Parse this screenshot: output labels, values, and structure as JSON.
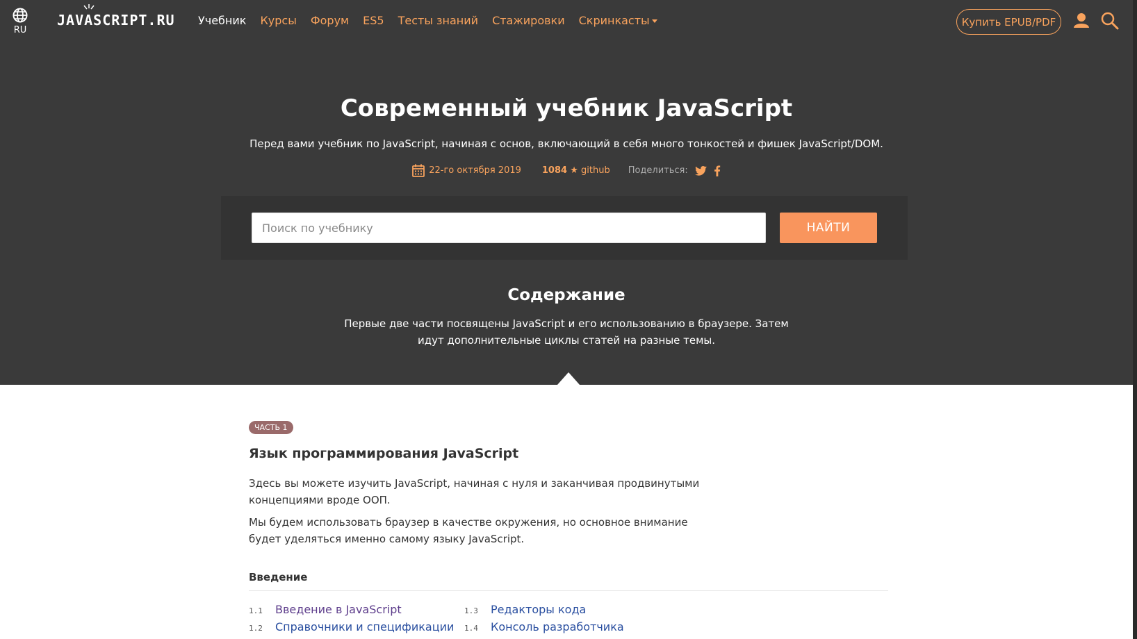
{
  "header": {
    "lang_label": "RU",
    "logo_text": "JAVASCRIPT.RU",
    "nav": [
      {
        "label": "Учебник",
        "active": true
      },
      {
        "label": "Курсы"
      },
      {
        "label": "Форум"
      },
      {
        "label": "ES5"
      },
      {
        "label": "Тесты знаний"
      },
      {
        "label": "Стажировки"
      },
      {
        "label": "Скринкасты",
        "dropdown": true
      }
    ],
    "buy_label": "Купить EPUB/PDF",
    "icons": [
      "globe-icon",
      "user-icon",
      "search-icon"
    ]
  },
  "hero": {
    "title": "Современный учебник JavaScript",
    "description": "Перед вами учебник по JavaScript, начиная с основ, включающий в себя много тонкостей и фишек JavaScript/DOM.",
    "date": "22-го октября 2019",
    "stars_count": "1084",
    "stars_suffix": "★ github",
    "share_label": "Поделиться:",
    "search_placeholder": "Поиск по учебнику",
    "search_button": "НАЙТИ",
    "toc_title": "Содержание",
    "toc_description": "Первые две части посвящены JavaScript и его использованию в браузере. Затем идут дополнительные циклы статей на разные темы."
  },
  "part": {
    "badge": "ЧАСТЬ 1",
    "title": "Язык программирования JavaScript",
    "paragraph1": "Здесь вы можете изучить JavaScript, начиная с нуля и заканчивая продвинутыми концепциями вроде ООП.",
    "paragraph2": "Мы будем использовать браузер в качестве окружения, но основное внимание будет уделяться именно самому языку JavaScript.",
    "section_title": "Введение",
    "items": [
      {
        "num": "1.1",
        "label": "Введение в JavaScript"
      },
      {
        "num": "1.2",
        "label": "Справочники и спецификации"
      },
      {
        "num": "1.3",
        "label": "Редакторы кода"
      },
      {
        "num": "1.4",
        "label": "Консоль разработчика"
      }
    ]
  },
  "colors": {
    "dark_bg": "#3a3a3a",
    "accent": "#f9a35d",
    "button": "#f9955d",
    "link": "#2a4fa0",
    "visited_link": "#5e3e8c",
    "badge": "#9a6a6a"
  }
}
